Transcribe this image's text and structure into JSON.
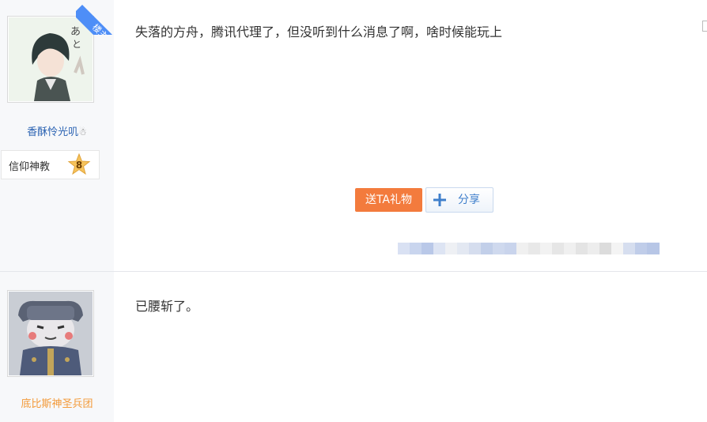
{
  "posts": [
    {
      "badge": "楼主",
      "username": "香酥怜光叽",
      "level": {
        "title": "信仰神教",
        "number": "8"
      },
      "content": "失落的方舟，腾讯代理了，但没听到什么消息了啊，啥时候能玩上",
      "actions": {
        "gift": "送TA礼物",
        "share": "分享"
      }
    },
    {
      "username": "底比斯神圣兵团",
      "content": "已腰斩了。"
    }
  ],
  "colors": {
    "accent_blue": "#4e8ef7",
    "gift_orange": "#f37b3d",
    "username_blue": "#2d64b3",
    "username_orange": "#f39a39"
  }
}
